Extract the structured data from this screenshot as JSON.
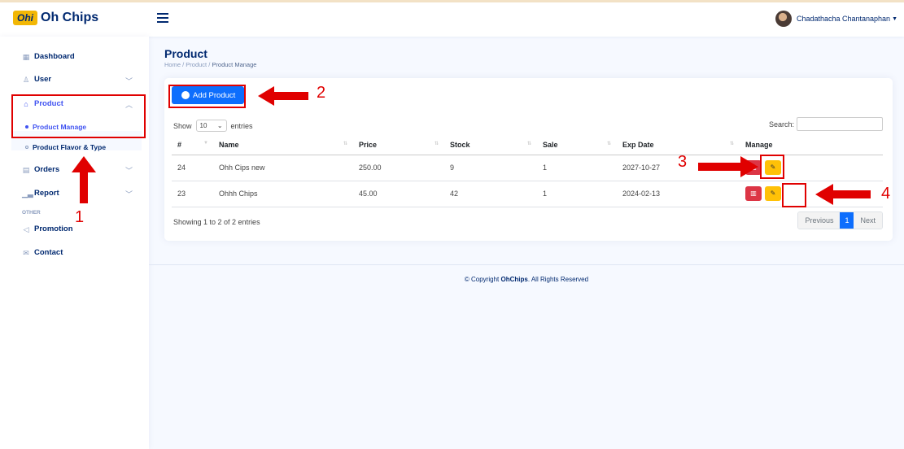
{
  "header": {
    "logo_mark": "Ohi",
    "logo_text": "Oh Chips",
    "user_name": "Chadathacha Chantanaphan"
  },
  "sidebar": {
    "items": [
      {
        "label": "Dashboard",
        "icon": "grid-icon"
      },
      {
        "label": "User",
        "icon": "person-icon"
      },
      {
        "label": "Product",
        "icon": "shop-icon"
      },
      {
        "label": "Orders",
        "icon": "receipt-icon"
      },
      {
        "label": "Report",
        "icon": "bar-chart-icon"
      },
      {
        "label": "Promotion",
        "icon": "megaphone-icon"
      },
      {
        "label": "Contact",
        "icon": "envelope-icon"
      }
    ],
    "product_sub": [
      {
        "label": "Product Manage"
      },
      {
        "label": "Product Flavor & Type"
      }
    ],
    "section_other": "OTHER"
  },
  "page": {
    "title": "Product",
    "breadcrumb": [
      "Home",
      "Product",
      "Product Manage"
    ]
  },
  "toolbar": {
    "add_label": "Add Product",
    "show_label": "Show",
    "entries_value": "10",
    "entries_label": "entries",
    "search_label": "Search:"
  },
  "table": {
    "headers": [
      "#",
      "Name",
      "Price",
      "Stock",
      "Sale",
      "Exp Date",
      "Manage"
    ],
    "rows": [
      [
        "24",
        "Ohh Cips new",
        "250.00",
        "9",
        "1",
        "2027-10-27"
      ],
      [
        "23",
        "Ohhh Chips",
        "45.00",
        "42",
        "1",
        "2024-02-13"
      ]
    ]
  },
  "footer_table": {
    "info": "Showing 1 to 2 of 2 entries",
    "prev": "Previous",
    "page": "1",
    "next": "Next"
  },
  "footer": {
    "prefix": "© Copyright",
    "brand": "OhChips",
    "suffix": ". All Rights Reserved"
  },
  "annotations": [
    "1",
    "2",
    "3",
    "4"
  ],
  "colors": {
    "accent": "#0d6efd",
    "annotation": "#e00000",
    "delete": "#dc3545",
    "edit": "#ffc107",
    "navy": "#012970"
  }
}
